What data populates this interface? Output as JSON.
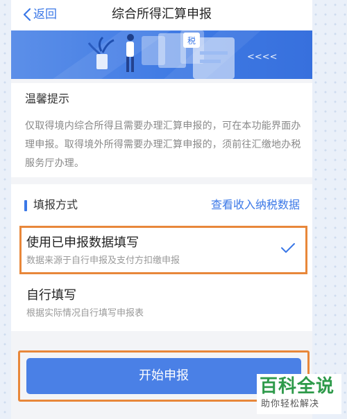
{
  "header": {
    "back_label": "返回",
    "title": "综合所得汇算申报"
  },
  "banner": {
    "badge_text": "税",
    "arrows_text": "<<<<"
  },
  "notice": {
    "title": "温馨提示",
    "body": "仅取得境内综合所得且需要办理汇算申报的，可在本功能界面办理申报。取得境外所得需要办理汇算申报的，须前往汇缴地办税服务厅办理。"
  },
  "method": {
    "section_title": "填报方式",
    "view_data_link": "查看收入纳税数据",
    "options": [
      {
        "title": "使用已申报数据填写",
        "subtitle": "数据来源于自行申报及支付方扣缴申报",
        "selected": true
      },
      {
        "title": "自行填写",
        "subtitle": "根据实际情况自行填写申报表",
        "selected": false
      }
    ]
  },
  "start_button": {
    "label": "开始申报"
  },
  "watermark": {
    "title": "百科全说",
    "subtitle": "助你轻松解决"
  },
  "colors": {
    "accent": "#3b78e7",
    "button": "#4a80e6",
    "highlight": "#e8873a",
    "watermark_green": "#2e9a4a"
  }
}
